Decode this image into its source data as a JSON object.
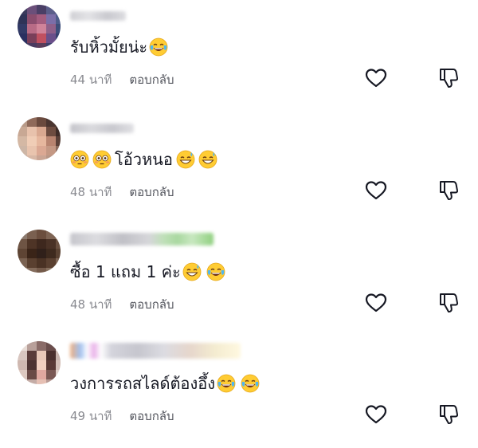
{
  "comments": [
    {
      "text": "รับหิ้วมั้ยน่ะ",
      "emojis": [
        "laugh-cry"
      ],
      "time": "44 นาที",
      "reply": "ตอบกลับ"
    },
    {
      "text": "โอ้วหนอ",
      "emojis_before": [
        "flushed",
        "flushed"
      ],
      "emojis": [
        "grin-sweat",
        "grin-sweat"
      ],
      "time": "48 นาที",
      "reply": "ตอบกลับ"
    },
    {
      "text": "ซื้อ 1 แถม 1 ค่ะ",
      "emojis": [
        "grin-sweat",
        "laugh-cry"
      ],
      "time": "48 นาที",
      "reply": "ตอบกลับ"
    },
    {
      "text": "วงการรถสไลด์ต้องอึ้ง",
      "emojis": [
        "laugh-cry",
        "laugh-cry"
      ],
      "time": "49 นาที",
      "reply": "ตอบกลับ"
    }
  ],
  "icons": {
    "like": "heart-outline-icon",
    "dislike": "thumbs-down-outline-icon"
  },
  "colors": {
    "meta_gray": "#8a8b91",
    "text": "#161823",
    "icon_stroke": "#161823"
  }
}
